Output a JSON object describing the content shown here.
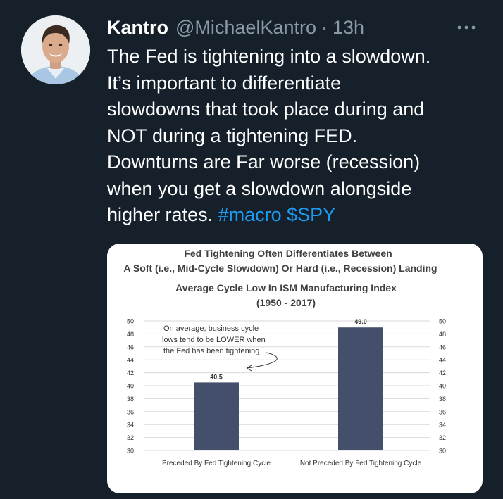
{
  "tweet": {
    "author_name": "Kantro",
    "handle": "@MichaelKantro",
    "separator": "·",
    "time": "13h",
    "more_icon": "more-horizontal-icon",
    "text_lines": [
      "The Fed is tightening into a slowdown.",
      "It’s important to differentiate",
      "slowdowns that took place during and",
      "NOT during a tightening FED.",
      "Downturns are Far worse (recession)",
      "when you get a slowdown alongside"
    ],
    "last_line_text": "higher rates.",
    "hashtag": "#macro",
    "cashtag": "$SPY",
    "colors": {
      "background": "#15202b",
      "link": "#1d9bf0",
      "muted": "#8b98a5"
    }
  },
  "chart_data": {
    "type": "bar",
    "title_lines": [
      "Fed Tightening Often Differentiates  Between",
      "A Soft (i.e., Mid-Cycle Slowdown) Or Hard (i.e., Recession) Landing"
    ],
    "subtitle_lines": [
      "Average Cycle Low In ISM Manufacturing Index",
      "(1950 - 2017)"
    ],
    "categories": [
      "Preceded By Fed Tightening Cycle",
      "Not Preceded By Fed Tightening Cycle"
    ],
    "values": [
      40.5,
      49.0
    ],
    "value_labels": [
      "40.5",
      "49.0"
    ],
    "ylim": [
      30,
      50
    ],
    "yticks": [
      "30",
      "32",
      "34",
      "36",
      "38",
      "40",
      "42",
      "44",
      "46",
      "48",
      "50"
    ],
    "dual_y_axis": true,
    "grid": true,
    "bar_color": "#44506b",
    "annotation_lines": [
      "On average, business cycle",
      "lows tend to be LOWER when",
      "the Fed has been tightening"
    ]
  }
}
